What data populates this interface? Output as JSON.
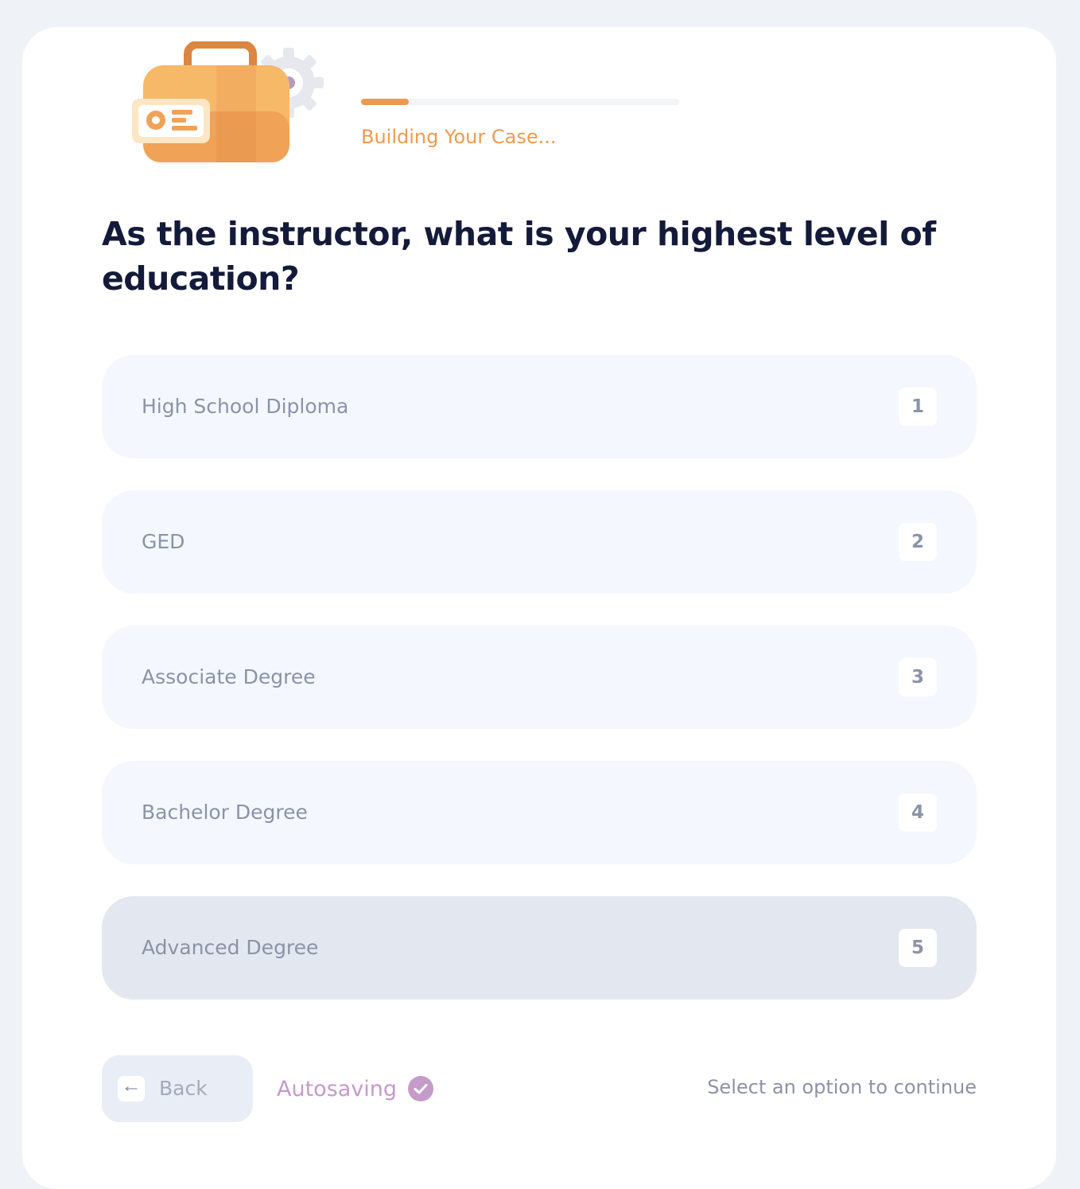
{
  "progress": {
    "label": "Building Your Case...",
    "fraction": 0.15,
    "color": "#ee9a4d"
  },
  "question": {
    "text": "As the instructor, what is your highest level of education?"
  },
  "options": [
    {
      "label": "High School Diploma",
      "key": "1"
    },
    {
      "label": "GED",
      "key": "2"
    },
    {
      "label": "Associate Degree",
      "key": "3"
    },
    {
      "label": "Bachelor Degree",
      "key": "4"
    },
    {
      "label": "Advanced Degree",
      "key": "5"
    }
  ],
  "footer": {
    "back_label": "Back",
    "back_icon": "arrow-left-icon",
    "autosave_label": "Autosaving",
    "autosave_icon": "check-circle-icon",
    "hint": "Select an option to continue"
  },
  "illustration_icon": "briefcase-id-gear-icon"
}
